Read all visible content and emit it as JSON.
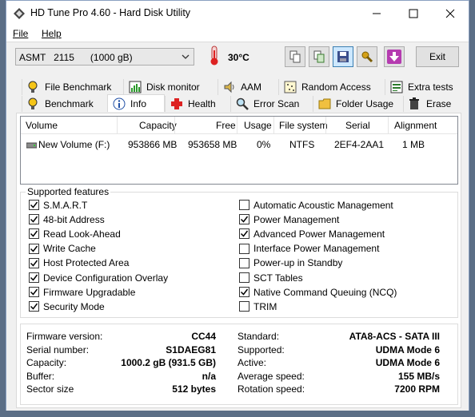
{
  "window": {
    "title": "HD Tune Pro 4.60 - Hard Disk Utility"
  },
  "menu": [
    "File",
    "Help"
  ],
  "toolbar": {
    "drive": "ASMT   2115      (1000 gB)",
    "temperature": "30°C",
    "exit_label": "Exit"
  },
  "tabs_top": [
    "File Benchmark",
    "Disk monitor",
    "AAM",
    "Random Access",
    "Extra tests"
  ],
  "tabs_bottom": [
    "Benchmark",
    "Info",
    "Health",
    "Error Scan",
    "Folder Usage",
    "Erase"
  ],
  "selected_tab": "Info",
  "volumes": {
    "headers": [
      "Volume",
      "Capacity",
      "Free",
      "Usage",
      "File system",
      "Serial",
      "Alignment"
    ],
    "rows": [
      [
        "New Volume (F:)",
        "953866 MB",
        "953658 MB",
        "0%",
        "NTFS",
        "2EF4-2AA1",
        "1 MB"
      ]
    ]
  },
  "features": {
    "title": "Supported features",
    "left": [
      {
        "label": "S.M.A.R.T",
        "checked": true
      },
      {
        "label": "48-bit Address",
        "checked": true
      },
      {
        "label": "Read Look-Ahead",
        "checked": true
      },
      {
        "label": "Write Cache",
        "checked": true
      },
      {
        "label": "Host Protected Area",
        "checked": true
      },
      {
        "label": "Device Configuration Overlay",
        "checked": true
      },
      {
        "label": "Firmware Upgradable",
        "checked": true
      },
      {
        "label": "Security Mode",
        "checked": true
      }
    ],
    "right": [
      {
        "label": "Automatic Acoustic Management",
        "checked": false
      },
      {
        "label": "Power Management",
        "checked": true
      },
      {
        "label": "Advanced Power Management",
        "checked": true
      },
      {
        "label": "Interface Power Management",
        "checked": false
      },
      {
        "label": "Power-up in Standby",
        "checked": false
      },
      {
        "label": "SCT Tables",
        "checked": false
      },
      {
        "label": "Native Command Queuing (NCQ)",
        "checked": true
      },
      {
        "label": "TRIM",
        "checked": false
      }
    ]
  },
  "info": {
    "left": [
      {
        "label": "Firmware version:",
        "value": "CC44"
      },
      {
        "label": "Serial number:",
        "value": "S1DAEG81"
      },
      {
        "label": "Capacity:",
        "value": "1000.2 gB (931.5 GB)"
      },
      {
        "label": "Buffer:",
        "value": "n/a"
      },
      {
        "label": "Sector size",
        "value": "512 bytes"
      }
    ],
    "right": [
      {
        "label": "Standard:",
        "value": "ATA8-ACS - SATA III"
      },
      {
        "label": "Supported:",
        "value": "UDMA Mode 6"
      },
      {
        "label": "Active:",
        "value": "UDMA Mode 6"
      },
      {
        "label": "Average speed:",
        "value": "155 MB/s"
      },
      {
        "label": "Rotation speed:",
        "value": "7200 RPM"
      }
    ]
  }
}
